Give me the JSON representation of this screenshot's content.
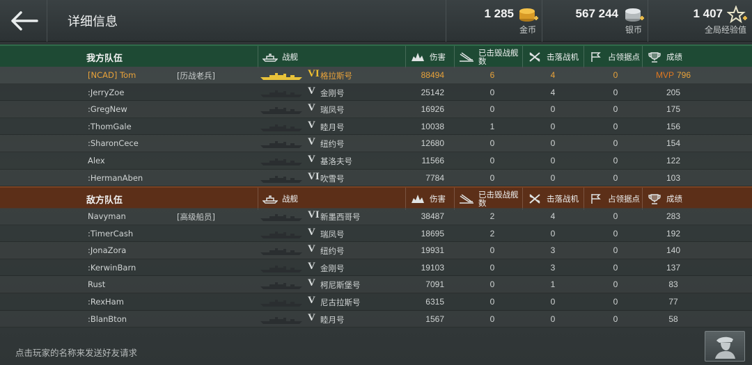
{
  "header": {
    "title": "详细信息",
    "currencies": [
      {
        "amount": "1 285",
        "label": "金币",
        "icon": "gold-coins-icon"
      },
      {
        "amount": "567 244",
        "label": "银币",
        "icon": "silver-coins-icon"
      },
      {
        "amount": "1 407",
        "label": "全局经验值",
        "icon": "free-xp-star-icon"
      }
    ]
  },
  "columns": {
    "ship": "战舰",
    "damage": "伤害",
    "ships_destroyed": "已击毁战舰\n数",
    "planes_destroyed": "击落战机",
    "base_capture": "占领据点",
    "score": "成绩"
  },
  "ally_team": {
    "name": "我方队伍",
    "players": [
      {
        "name": "[NCAD] Tom",
        "tag": "[历战老兵]",
        "tier": "VI",
        "ship": "格拉斯号",
        "damage": "88494",
        "kills": "6",
        "planes": "4",
        "caps": "0",
        "mvp": "MVP",
        "score": "796"
      },
      {
        "name": ":JerryZoe",
        "tag": "",
        "tier": "V",
        "ship": "金刚号",
        "damage": "25142",
        "kills": "0",
        "planes": "4",
        "caps": "0",
        "mvp": "",
        "score": "205"
      },
      {
        "name": ":GregNew",
        "tag": "",
        "tier": "V",
        "ship": "瑞凤号",
        "damage": "16926",
        "kills": "0",
        "planes": "0",
        "caps": "0",
        "mvp": "",
        "score": "175"
      },
      {
        "name": ":ThomGale",
        "tag": "",
        "tier": "V",
        "ship": "睦月号",
        "damage": "10038",
        "kills": "1",
        "planes": "0",
        "caps": "0",
        "mvp": "",
        "score": "156"
      },
      {
        "name": ":SharonCece",
        "tag": "",
        "tier": "V",
        "ship": "纽约号",
        "damage": "12680",
        "kills": "0",
        "planes": "0",
        "caps": "0",
        "mvp": "",
        "score": "154"
      },
      {
        "name": "Alex",
        "tag": "",
        "tier": "V",
        "ship": "基洛夫号",
        "damage": "11566",
        "kills": "0",
        "planes": "0",
        "caps": "0",
        "mvp": "",
        "score": "122"
      },
      {
        "name": ":HermanAben",
        "tag": "",
        "tier": "VI",
        "ship": "吹雪号",
        "damage": "7784",
        "kills": "0",
        "planes": "0",
        "caps": "0",
        "mvp": "",
        "score": "103"
      }
    ]
  },
  "enemy_team": {
    "name": "敌方队伍",
    "players": [
      {
        "name": "Navyman",
        "tag": "[高级船员]",
        "tier": "VI",
        "ship": "新墨西哥号",
        "damage": "38487",
        "kills": "2",
        "planes": "4",
        "caps": "0",
        "mvp": "",
        "score": "283"
      },
      {
        "name": ":TimerCash",
        "tag": "",
        "tier": "V",
        "ship": "瑞凤号",
        "damage": "18695",
        "kills": "2",
        "planes": "0",
        "caps": "0",
        "mvp": "",
        "score": "192"
      },
      {
        "name": ":JonaZora",
        "tag": "",
        "tier": "V",
        "ship": "纽约号",
        "damage": "19931",
        "kills": "0",
        "planes": "3",
        "caps": "0",
        "mvp": "",
        "score": "140"
      },
      {
        "name": ":KerwinBarn",
        "tag": "",
        "tier": "V",
        "ship": "金刚号",
        "damage": "19103",
        "kills": "0",
        "planes": "3",
        "caps": "0",
        "mvp": "",
        "score": "137"
      },
      {
        "name": "Rust",
        "tag": "",
        "tier": "V",
        "ship": "柯尼斯堡号",
        "damage": "7091",
        "kills": "0",
        "planes": "1",
        "caps": "0",
        "mvp": "",
        "score": "83"
      },
      {
        "name": ":RexHam",
        "tag": "",
        "tier": "V",
        "ship": "尼古拉斯号",
        "damage": "6315",
        "kills": "0",
        "planes": "0",
        "caps": "0",
        "mvp": "",
        "score": "77"
      },
      {
        "name": ":BlanBton",
        "tag": "",
        "tier": "V",
        "ship": "睦月号",
        "damage": "1567",
        "kills": "0",
        "planes": "0",
        "caps": "0",
        "mvp": "",
        "score": "58"
      }
    ]
  },
  "footer": {
    "hint": "点击玩家的名称来发送好友请求"
  }
}
